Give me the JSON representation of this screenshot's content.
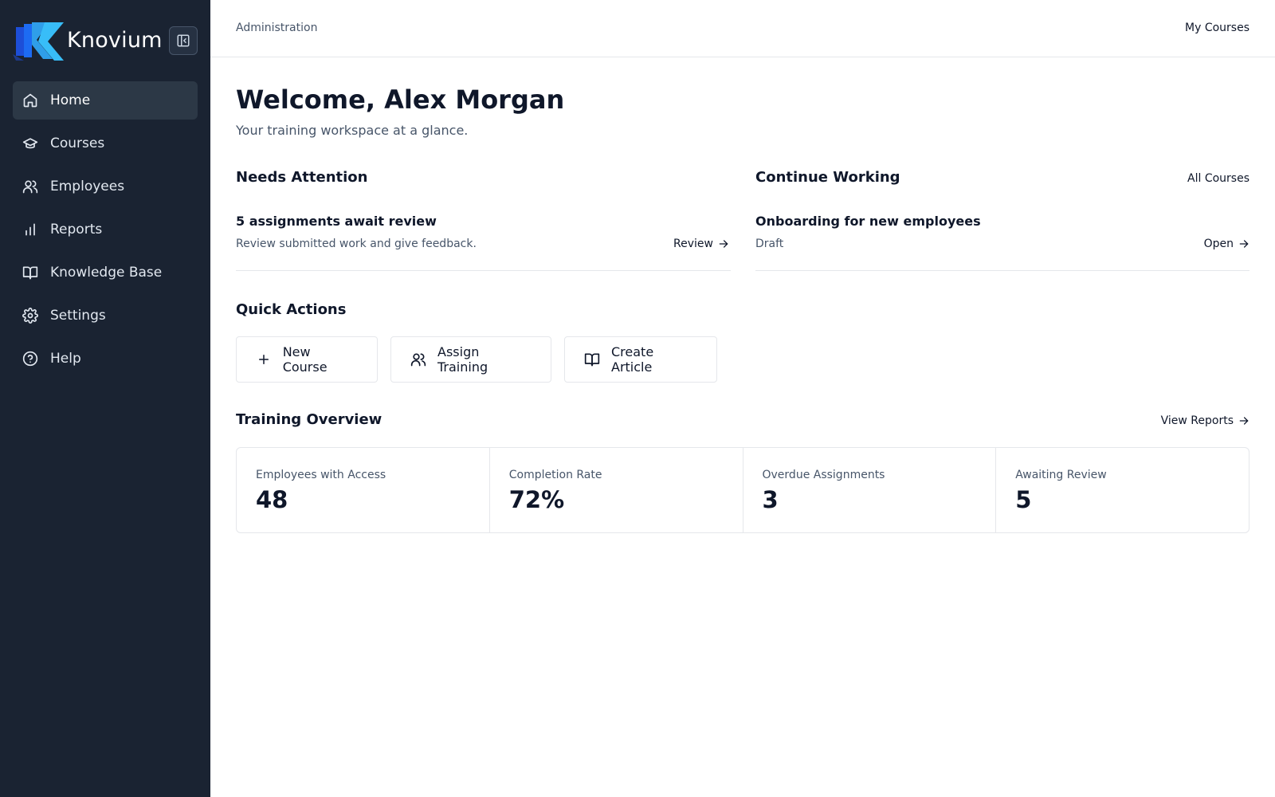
{
  "brand": {
    "name": "Knovium"
  },
  "colors": {
    "sidebar": "#1a2332",
    "active_item": "#2c3846",
    "logo_blue": "#1d6bf3"
  },
  "sidebar": {
    "items": [
      {
        "label": "Home",
        "icon": "home-icon",
        "active": true
      },
      {
        "label": "Courses",
        "icon": "graduation-cap-icon"
      },
      {
        "label": "Employees",
        "icon": "users-icon"
      },
      {
        "label": "Reports",
        "icon": "bar-chart-icon"
      },
      {
        "label": "Knowledge Base",
        "icon": "book-icon"
      },
      {
        "label": "Settings",
        "icon": "gear-icon"
      },
      {
        "label": "Help",
        "icon": "help-circle-icon"
      }
    ]
  },
  "topbar": {
    "breadcrumb": "Administration",
    "my_courses": "My Courses"
  },
  "main": {
    "welcome": "Welcome, Alex Morgan",
    "subtitle": "Your training workspace at a glance.",
    "needs_attention": {
      "title": "Needs Attention",
      "item_title": "5 assignments await review",
      "item_sub": "Review submitted work and give feedback.",
      "action": "Review"
    },
    "continue_working": {
      "title": "Continue Working",
      "all_link": "All Courses",
      "item_title": "Onboarding for new employees",
      "item_sub": "Draft",
      "action": "Open"
    },
    "quick_actions": {
      "title": "Quick Actions",
      "new_course": "New Course",
      "assign_training": "Assign Training",
      "create_article": "Create Article"
    },
    "overview": {
      "title": "Training Overview",
      "view_reports": "View Reports",
      "stats": [
        {
          "label": "Employees with Access",
          "value": "48"
        },
        {
          "label": "Completion Rate",
          "value": "72%"
        },
        {
          "label": "Overdue Assignments",
          "value": "3"
        },
        {
          "label": "Awaiting Review",
          "value": "5"
        }
      ]
    }
  }
}
